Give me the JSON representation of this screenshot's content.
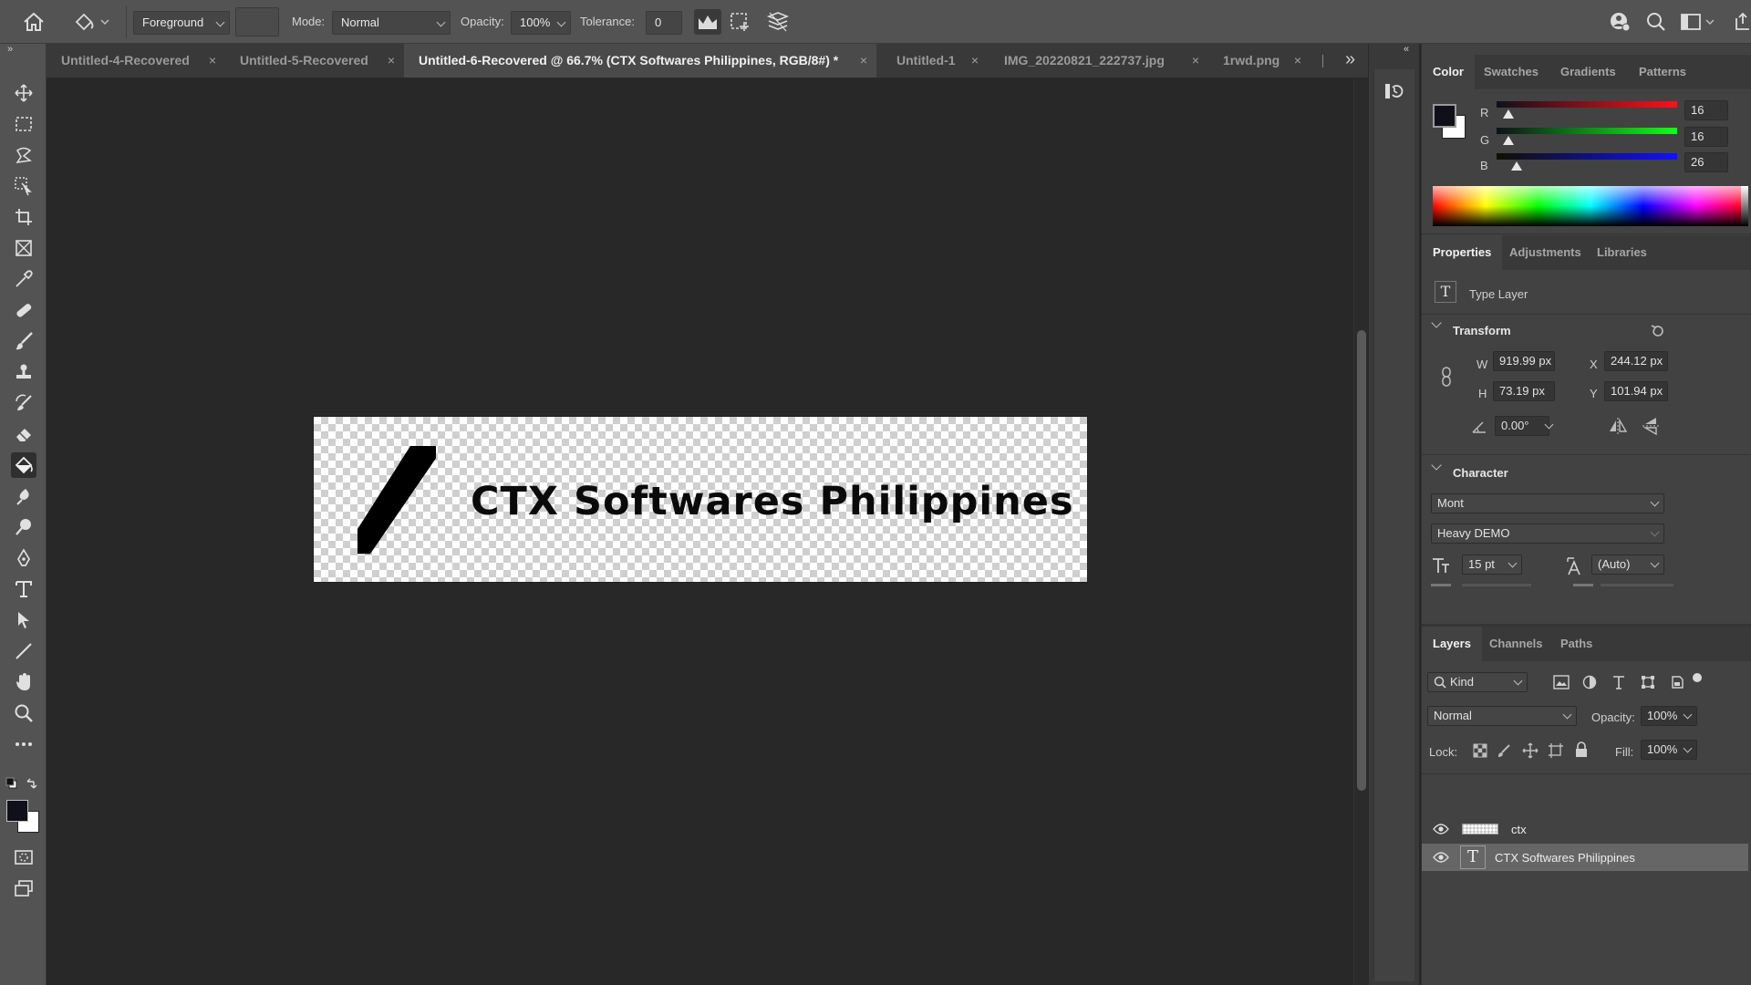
{
  "colors": {
    "accent": "#4a4a4a",
    "fg_swatch": "#10101a",
    "bg_swatch": "#ffffff"
  },
  "options_bar": {
    "fill_source": "Foreground",
    "mode_label": "Mode:",
    "mode_value": "Normal",
    "opacity_label": "Opacity:",
    "opacity_value": "100%",
    "tolerance_label": "Tolerance:",
    "tolerance_value": "0"
  },
  "tabs": [
    {
      "label": "Untitled-4-Recovered",
      "close": "×"
    },
    {
      "label": "Untitled-5-Recovered",
      "close": "×"
    },
    {
      "label": "Untitled-6-Recovered @ 66.7% (CTX Softwares Philippines, RGB/8#) *",
      "close": "×"
    },
    {
      "label": "Untitled-1",
      "close": "×"
    },
    {
      "label": "IMG_20220821_222737.jpg",
      "close": "×"
    },
    {
      "label": "1rwd.png",
      "close": "×"
    }
  ],
  "tabs_overflow": "»",
  "canvas": {
    "text": "CTX Softwares Philippines"
  },
  "color_panel": {
    "tabs": [
      "Color",
      "Swatches",
      "Gradients",
      "Patterns"
    ],
    "r_label": "R",
    "r_value": "16",
    "g_label": "G",
    "g_value": "16",
    "b_label": "B",
    "b_value": "26"
  },
  "properties_panel": {
    "tabs": [
      "Properties",
      "Adjustments",
      "Libraries"
    ],
    "layer_type": "Type Layer",
    "transform_title": "Transform",
    "w_label": "W",
    "w_value": "919.99 px",
    "h_label": "H",
    "h_value": "73.19 px",
    "x_label": "X",
    "x_value": "244.12 px",
    "y_label": "Y",
    "y_value": "101.94 px",
    "angle_value": "0.00°",
    "character_title": "Character",
    "font_family": "Mont",
    "font_style": "Heavy DEMO",
    "font_size": "15 pt",
    "leading": "(Auto)"
  },
  "layers_panel": {
    "tabs": [
      "Layers",
      "Channels",
      "Paths"
    ],
    "filter_kind": "Kind",
    "blend_mode": "Normal",
    "opacity_label": "Opacity:",
    "opacity_value": "100%",
    "lock_label": "Lock:",
    "fill_label": "Fill:",
    "fill_value": "100%",
    "layers": [
      {
        "name": "ctx"
      },
      {
        "name": "CTX Softwares Philippines"
      }
    ]
  }
}
